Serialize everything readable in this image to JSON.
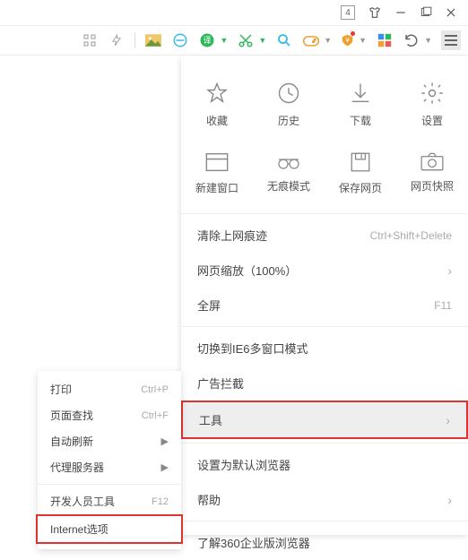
{
  "titlebar": {
    "badge": "4"
  },
  "grid1": [
    {
      "label": "收藏",
      "icon": "star"
    },
    {
      "label": "历史",
      "icon": "clock"
    },
    {
      "label": "下载",
      "icon": "download"
    },
    {
      "label": "设置",
      "icon": "gear"
    }
  ],
  "grid2": [
    {
      "label": "新建窗口",
      "icon": "window"
    },
    {
      "label": "无痕模式",
      "icon": "incognito"
    },
    {
      "label": "保存网页",
      "icon": "save"
    },
    {
      "label": "网页快照",
      "icon": "camera"
    }
  ],
  "rows": {
    "clear": {
      "label": "清除上网痕迹",
      "hint": "Ctrl+Shift+Delete"
    },
    "zoom": {
      "label": "网页缩放（100%）"
    },
    "full": {
      "label": "全屏",
      "hint": "F11"
    },
    "ie6": {
      "label": "切换到IE6多窗口模式"
    },
    "adblock": {
      "label": "广告拦截"
    },
    "tools": {
      "label": "工具"
    },
    "default": {
      "label": "设置为默认浏览器"
    },
    "help": {
      "label": "帮助"
    },
    "about": {
      "label": "了解360企业版浏览器"
    }
  },
  "sub": {
    "print": {
      "label": "打印",
      "hint": "Ctrl+P"
    },
    "find": {
      "label": "页面查找",
      "hint": "Ctrl+F"
    },
    "refresh": {
      "label": "自动刷新"
    },
    "proxy": {
      "label": "代理服务器"
    },
    "dev": {
      "label": "开发人员工具",
      "hint": "F12"
    },
    "inet": {
      "label": "Internet选项"
    }
  }
}
